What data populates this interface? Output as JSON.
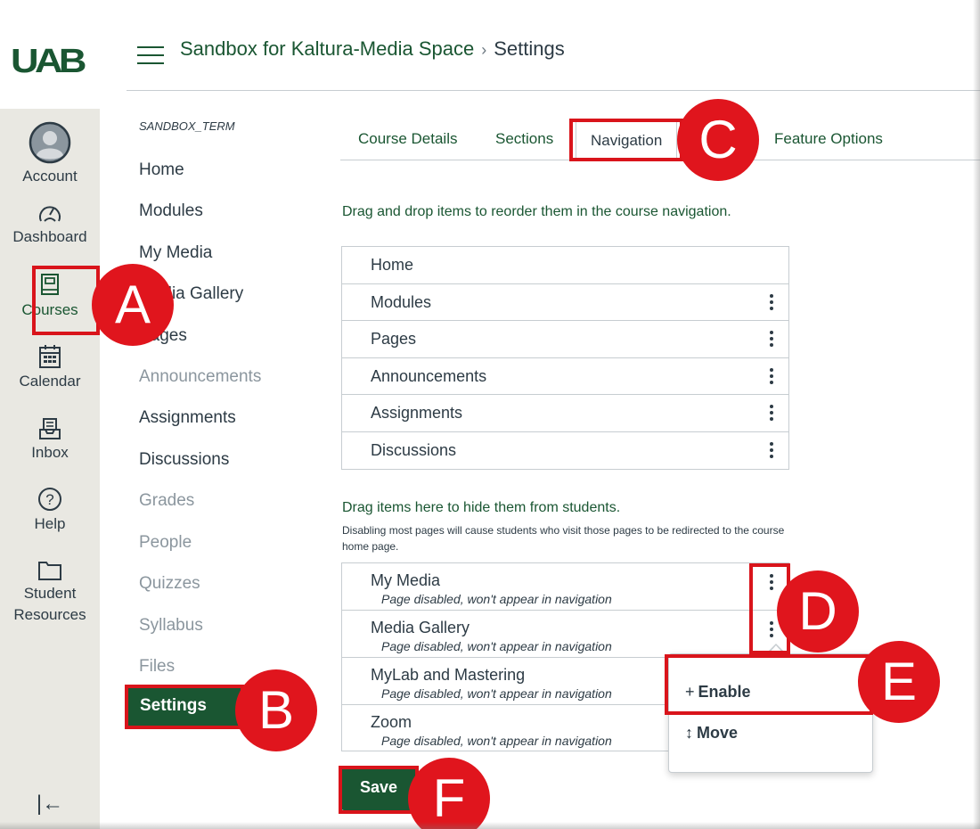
{
  "logo": {
    "text": "UAB"
  },
  "global_nav": {
    "items": [
      {
        "label": "Account",
        "icon": "avatar-icon"
      },
      {
        "label": "Dashboard",
        "icon": "dashboard-icon"
      },
      {
        "label": "Courses",
        "icon": "courses-icon"
      },
      {
        "label": "Calendar",
        "icon": "calendar-icon"
      },
      {
        "label": "Inbox",
        "icon": "inbox-icon"
      },
      {
        "label": "Help",
        "icon": "help-icon"
      },
      {
        "label": "Student",
        "label2": "Resources",
        "icon": "folder-icon"
      }
    ],
    "collapse_glyph": "|←"
  },
  "header": {
    "course_link": "Sandbox for Kaltura-Media Space",
    "separator": "›",
    "current": "Settings"
  },
  "course_nav": {
    "term": "SANDBOX_TERM",
    "items": [
      {
        "label": "Home",
        "disabled": false
      },
      {
        "label": "Modules",
        "disabled": false
      },
      {
        "label": "My Media",
        "disabled": false
      },
      {
        "label": "Media Gallery",
        "disabled": false
      },
      {
        "label": "Pages",
        "disabled": false
      },
      {
        "label": "Announcements",
        "disabled": true
      },
      {
        "label": "Assignments",
        "disabled": false
      },
      {
        "label": "Discussions",
        "disabled": false
      },
      {
        "label": "Grades",
        "disabled": true
      },
      {
        "label": "People",
        "disabled": true
      },
      {
        "label": "Quizzes",
        "disabled": true
      },
      {
        "label": "Syllabus",
        "disabled": true
      },
      {
        "label": "Files",
        "disabled": true
      }
    ],
    "settings_label": "Settings"
  },
  "tabs": [
    {
      "label": "Course Details"
    },
    {
      "label": "Sections"
    },
    {
      "label": "Navigation"
    },
    {
      "label": "Feature Options"
    }
  ],
  "navigation": {
    "instructions": "Drag and drop items to reorder them in the course navigation.",
    "enabled_items": [
      "Home",
      "Modules",
      "Pages",
      "Announcements",
      "Assignments",
      "Discussions"
    ],
    "hidden_title": "Drag items here to hide them from students.",
    "hidden_note": "Disabling most pages will cause students who visit those pages to be redirected to the course home page.",
    "disabled_items": [
      {
        "label": "My Media",
        "status": "Page disabled, won't appear in navigation"
      },
      {
        "label": "Media Gallery",
        "status": "Page disabled, won't appear in navigation"
      },
      {
        "label": "MyLab and Mastering",
        "status": "Page disabled, won't appear in navigation"
      },
      {
        "label": "Zoom",
        "status": "Page disabled, won't appear in navigation"
      }
    ]
  },
  "menu": {
    "enable_icon": "+",
    "enable_label": "Enable",
    "move_icon": "↕",
    "move_label": "Move"
  },
  "save_label": "Save",
  "callouts": [
    "A",
    "B",
    "C",
    "D",
    "E",
    "F"
  ],
  "colors": {
    "brand_green": "#1a5632",
    "callout_red": "#e0151d"
  }
}
